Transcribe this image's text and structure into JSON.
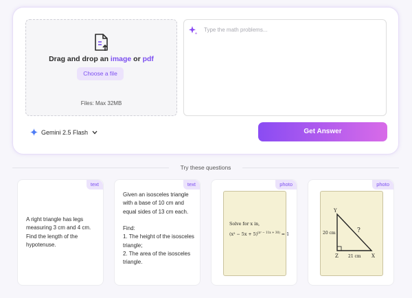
{
  "upload": {
    "drag_text": "Drag and drop an ",
    "image_link": "image",
    "or_text": " or ",
    "pdf_link": "pdf",
    "choose_button": "Choose a file",
    "limit": "Files: Max 32MB"
  },
  "input": {
    "placeholder": "Type the math problems..."
  },
  "model": {
    "name": "Gemini 2.5 Flash"
  },
  "action": {
    "get_answer": "Get Answer"
  },
  "try_label": "Try these questions",
  "colors": {
    "accent": "#7c4ff0",
    "tag_bg": "#ece3fc",
    "button_start": "#8a4cf3",
    "button_end": "#d86be8",
    "photo_bg": "#f5f1d4"
  },
  "questions": [
    {
      "tag": "text",
      "text": "A right triangle has legs measuring 3 cm and 4 cm. Find the length of the hypotenuse."
    },
    {
      "tag": "text",
      "text": "Given an isosceles triangle with a base of 10 cm and equal sides of 13 cm each.\n\nFind:\n1. The height of the isosceles triangle;\n2. The area of the isosceles triangle."
    },
    {
      "tag": "photo",
      "line1": "Solve for x in,",
      "eq_base": "(x² − 5x + 5)",
      "eq_exp": "(x² − 11x + 30)",
      "eq_rhs": " = 1"
    },
    {
      "tag": "photo",
      "y": "Y",
      "z": "Z",
      "x": "X",
      "side": "20 cm",
      "base": "21 cm",
      "unknown": "?"
    }
  ]
}
